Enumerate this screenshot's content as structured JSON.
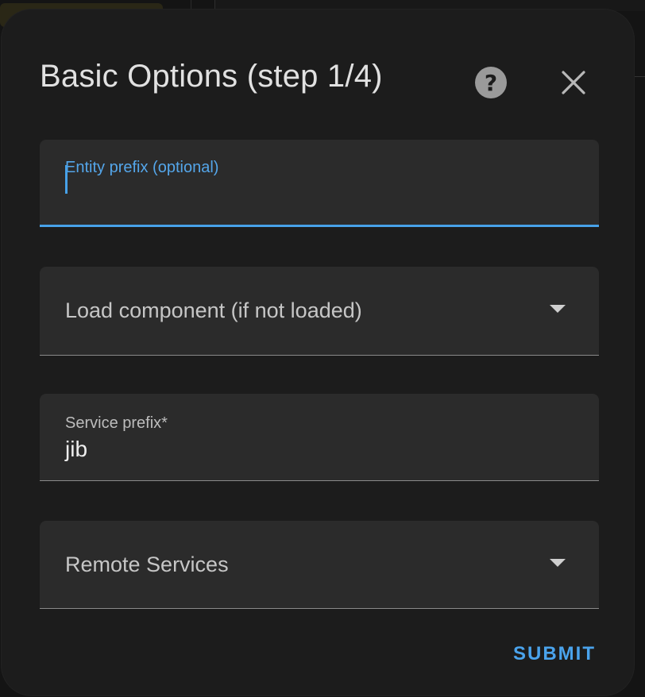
{
  "dialog": {
    "title": "Basic Options (step 1/4)",
    "help_icon": "question-circle-icon",
    "close_icon": "close-icon"
  },
  "fields": {
    "entity_prefix": {
      "label": "Entity prefix (optional)",
      "value": ""
    },
    "load_component": {
      "label": "Load component (if not loaded)",
      "icon": "chevron-down-icon"
    },
    "service_prefix": {
      "label": "Service prefix*",
      "value": "jib"
    },
    "remote_services": {
      "label": "Remote Services",
      "icon": "chevron-down-icon"
    }
  },
  "actions": {
    "submit_label": "SUBMIT"
  },
  "colors": {
    "accent": "#47a1e8",
    "dialog_bg": "#1c1c1c",
    "field_bg": "#2b2b2b"
  }
}
